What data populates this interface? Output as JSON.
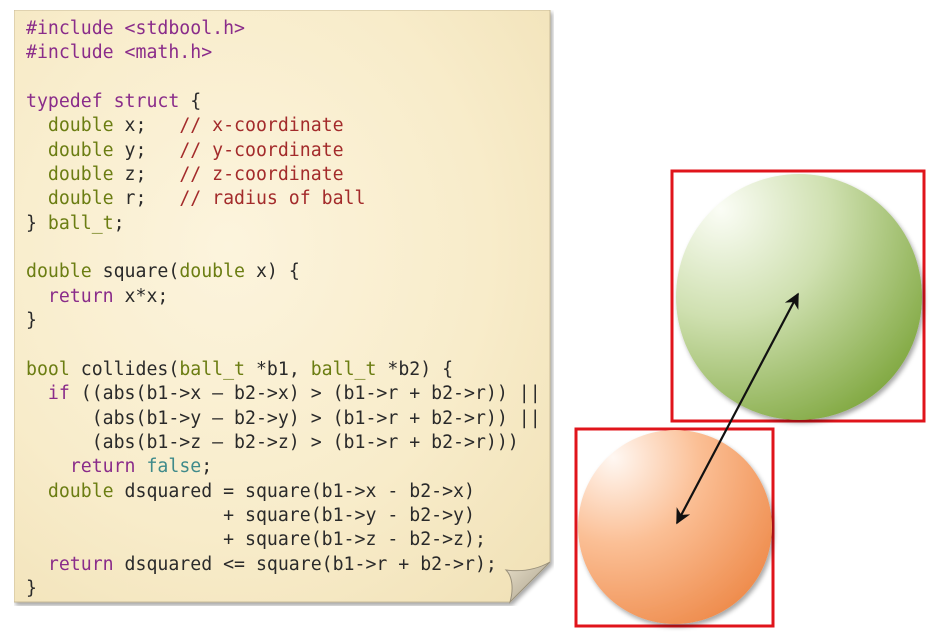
{
  "code_lines": [
    [
      {
        "t": "#include <stdbool.h>",
        "c": "pp"
      }
    ],
    [
      {
        "t": "#include <math.h>",
        "c": "pp"
      }
    ],
    [],
    [
      {
        "t": "typedef",
        "c": "kw"
      },
      {
        "t": " ",
        "c": "op"
      },
      {
        "t": "struct",
        "c": "kw"
      },
      {
        "t": " {",
        "c": "op"
      }
    ],
    [
      {
        "t": "  ",
        "c": "op"
      },
      {
        "t": "double",
        "c": "type"
      },
      {
        "t": " x;   ",
        "c": "id"
      },
      {
        "t": "// x-coordinate",
        "c": "cmt"
      }
    ],
    [
      {
        "t": "  ",
        "c": "op"
      },
      {
        "t": "double",
        "c": "type"
      },
      {
        "t": " y;   ",
        "c": "id"
      },
      {
        "t": "// y-coordinate",
        "c": "cmt"
      }
    ],
    [
      {
        "t": "  ",
        "c": "op"
      },
      {
        "t": "double",
        "c": "type"
      },
      {
        "t": " z;   ",
        "c": "id"
      },
      {
        "t": "// z-coordinate",
        "c": "cmt"
      }
    ],
    [
      {
        "t": "  ",
        "c": "op"
      },
      {
        "t": "double",
        "c": "type"
      },
      {
        "t": " r;   ",
        "c": "id"
      },
      {
        "t": "// radius of ball",
        "c": "cmt"
      }
    ],
    [
      {
        "t": "} ",
        "c": "op"
      },
      {
        "t": "ball_t",
        "c": "type"
      },
      {
        "t": ";",
        "c": "op"
      }
    ],
    [],
    [
      {
        "t": "double",
        "c": "type"
      },
      {
        "t": " square(",
        "c": "id"
      },
      {
        "t": "double",
        "c": "type"
      },
      {
        "t": " x) {",
        "c": "id"
      }
    ],
    [
      {
        "t": "  ",
        "c": "op"
      },
      {
        "t": "return",
        "c": "kw"
      },
      {
        "t": " x*x;",
        "c": "id"
      }
    ],
    [
      {
        "t": "}",
        "c": "op"
      }
    ],
    [],
    [
      {
        "t": "bool",
        "c": "type"
      },
      {
        "t": " collides(",
        "c": "id"
      },
      {
        "t": "ball_t",
        "c": "type"
      },
      {
        "t": " *b1, ",
        "c": "id"
      },
      {
        "t": "ball_t",
        "c": "type"
      },
      {
        "t": " *b2) {",
        "c": "id"
      }
    ],
    [
      {
        "t": "  ",
        "c": "op"
      },
      {
        "t": "if",
        "c": "kw"
      },
      {
        "t": " ((abs(b1->x – b2->x) > (b1->r + b2->r)) ||",
        "c": "id"
      }
    ],
    [
      {
        "t": "      (abs(b1->y – b2->y) > (b1->r + b2->r)) ||",
        "c": "id"
      }
    ],
    [
      {
        "t": "      (abs(b1->z – b2->z) > (b1->r + b2->r)))",
        "c": "id"
      }
    ],
    [
      {
        "t": "    ",
        "c": "op"
      },
      {
        "t": "return",
        "c": "kw"
      },
      {
        "t": " ",
        "c": "op"
      },
      {
        "t": "false",
        "c": "lit"
      },
      {
        "t": ";",
        "c": "op"
      }
    ],
    [
      {
        "t": "  ",
        "c": "op"
      },
      {
        "t": "double",
        "c": "type"
      },
      {
        "t": " dsquared = square(b1->x - b2->x)",
        "c": "id"
      }
    ],
    [
      {
        "t": "                  + square(b1->y - b2->y)",
        "c": "id"
      }
    ],
    [
      {
        "t": "                  + square(b1->z - b2->z);",
        "c": "id"
      }
    ],
    [
      {
        "t": "  ",
        "c": "op"
      },
      {
        "t": "return",
        "c": "kw"
      },
      {
        "t": " dsquared <= square(b1->r + b2->r);",
        "c": "id"
      }
    ],
    [
      {
        "t": "}",
        "c": "op"
      }
    ]
  ],
  "diagram": {
    "box_color": "#e0141b",
    "green_ball_colors": [
      "#fbfdf6",
      "#cfe0b0",
      "#7fa73f"
    ],
    "orange_ball_colors": [
      "#fff8f3",
      "#fbbf95",
      "#ee8a4a"
    ],
    "arrow_color": "#111111"
  },
  "colors": {
    "paper": "#faf0d4",
    "paper_edge": "#c9bb98"
  }
}
